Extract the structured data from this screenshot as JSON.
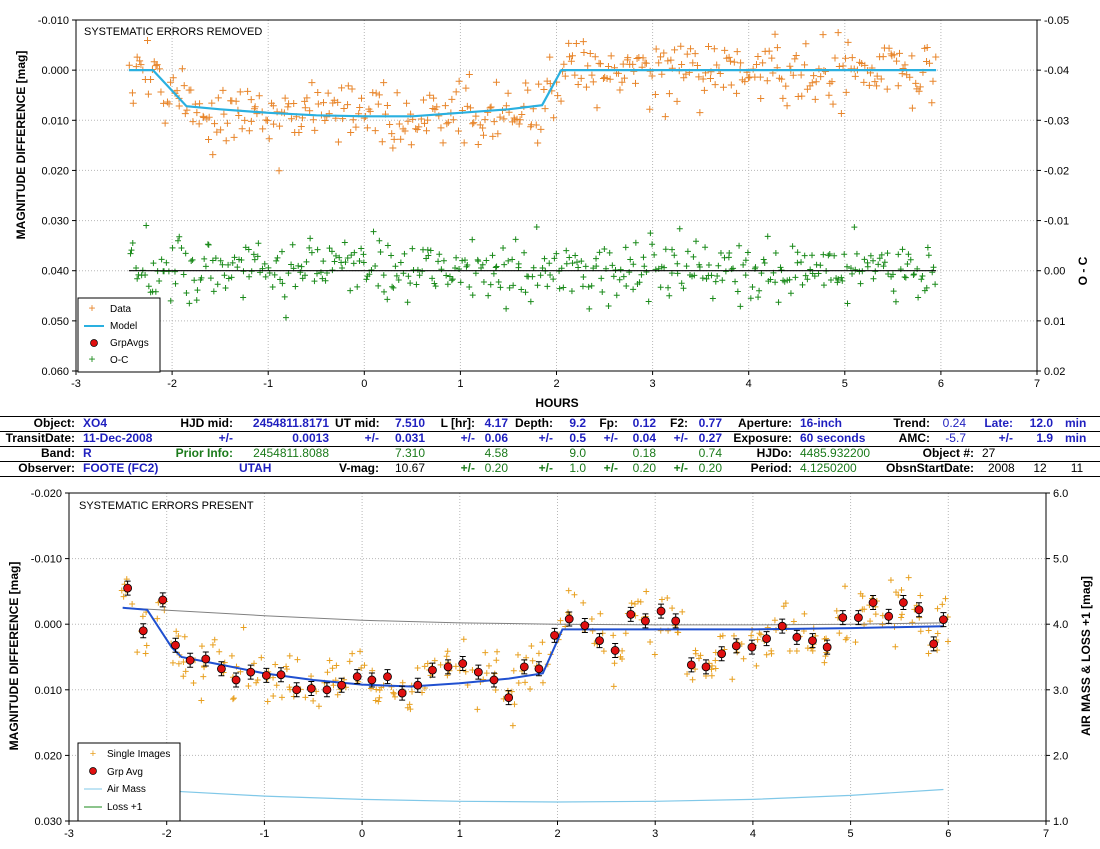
{
  "chart_data": [
    {
      "type": "scatter",
      "title": "SYSTEMATIC ERRORS REMOVED",
      "xlabel": "HOURS",
      "ylabel": "MAGNITUDE DIFFERENCE [mag]",
      "y2label": "O - C",
      "xlim": [
        -3,
        7
      ],
      "ylim": [
        -0.01,
        0.06
      ],
      "y_inverted": true,
      "y2lim": [
        -0.05,
        0.02
      ],
      "x_ticks": [
        "-3",
        "-2",
        "-1",
        "0",
        "1",
        "2",
        "3",
        "4",
        "5",
        "6",
        "7"
      ],
      "y_ticks": [
        "-0.010",
        "0.000",
        "0.010",
        "0.020",
        "0.030",
        "0.040",
        "0.050",
        "0.060"
      ],
      "y2_ticks": [
        "-0.05",
        "-0.04",
        "-0.03",
        "-0.02",
        "-0.01",
        "0.00",
        "0.01",
        "0.02"
      ],
      "grid": true,
      "legend_position": "bottom-left",
      "legend": [
        "Data",
        "Model",
        "GrpAvgs",
        "O-C"
      ],
      "colors": {
        "data": "#e8852a",
        "model": "#2ab0e0",
        "grpavg": "#e01010",
        "oc": "#1a8a1a"
      },
      "model": {
        "x": [
          -2.45,
          -2.2,
          -1.85,
          -1.5,
          -1.0,
          -0.5,
          0.0,
          0.5,
          1.0,
          1.5,
          1.85,
          2.05,
          2.5,
          3.0,
          4.0,
          5.0,
          5.95
        ],
        "y": [
          0.0,
          0.0,
          0.0072,
          0.0078,
          0.0085,
          0.009,
          0.0092,
          0.0092,
          0.0085,
          0.0078,
          0.007,
          0.0,
          0.0,
          0.0,
          0.0,
          0.0,
          0.0
        ]
      },
      "oc_zero_line": {
        "x": [
          -2.45,
          5.95
        ],
        "y": [
          0.0,
          0.0
        ]
      },
      "data_segments": [
        {
          "x_range": [
            -2.45,
            -2.1
          ],
          "center": 0.0,
          "scatter": 0.003
        },
        {
          "x_range": [
            -2.1,
            -1.85
          ],
          "center": 0.005,
          "scatter": 0.003
        },
        {
          "x_range": [
            -1.85,
            1.85
          ],
          "center": 0.0088,
          "scatter": 0.003
        },
        {
          "x_range": [
            1.85,
            2.05
          ],
          "center": 0.004,
          "scatter": 0.004
        },
        {
          "x_range": [
            2.05,
            5.95
          ],
          "center": 0.0,
          "scatter": 0.003
        }
      ],
      "oc_segment": {
        "x_range": [
          -2.45,
          5.95
        ],
        "center": 0.0,
        "scatter": 0.003
      }
    },
    {
      "type": "scatter",
      "title": "SYSTEMATIC ERRORS PRESENT",
      "xlabel": "",
      "ylabel": "MAGNITUDE DIFFERENCE [mag]",
      "y2label": "AIR MASS & LOSS +1 [mag]",
      "xlim": [
        -3,
        7
      ],
      "ylim": [
        -0.02,
        0.03
      ],
      "y_inverted": true,
      "y2lim": [
        1.0,
        6.0
      ],
      "x_ticks": [
        "-3",
        "-2",
        "-1",
        "0",
        "1",
        "2",
        "3",
        "4",
        "5",
        "6",
        "7"
      ],
      "y_ticks": [
        "-0.020",
        "-0.010",
        "0.000",
        "0.010",
        "0.020",
        "0.030"
      ],
      "y2_ticks": [
        "1.0",
        "2.0",
        "3.0",
        "4.0",
        "5.0",
        "6.0"
      ],
      "grid": true,
      "legend_position": "bottom-left",
      "legend": [
        "Single Images",
        "Grp Avg",
        "Air Mass",
        "Loss +1"
      ],
      "colors": {
        "single": "#e8a020",
        "grpavg": "#e01010",
        "model": "#2050d0",
        "airmass": "#80c8e8",
        "loss": "#1a8a1a",
        "trend": "#808080"
      },
      "model": {
        "x": [
          -2.45,
          -2.2,
          -1.95,
          -1.85,
          -1.5,
          -1.0,
          -0.5,
          0.0,
          0.5,
          1.0,
          1.5,
          1.85,
          2.05,
          2.5,
          3.0,
          4.0,
          5.0,
          5.95
        ],
        "y": [
          -0.0025,
          -0.0022,
          0.0035,
          0.005,
          0.006,
          0.0075,
          0.0085,
          0.0092,
          0.0095,
          0.009,
          0.0083,
          0.0075,
          0.0008,
          0.0008,
          0.0008,
          0.0008,
          0.0006,
          0.0003
        ]
      },
      "trend": {
        "x": [
          -2.45,
          -1.0,
          0.0,
          1.0,
          2.0,
          3.0,
          4.0,
          5.0,
          5.95
        ],
        "y": [
          -0.0025,
          -0.0013,
          -0.0006,
          -0.0002,
          0.0,
          0.0001,
          0.0001,
          0.0,
          -0.0002
        ]
      },
      "air_mass": {
        "x": [
          -2.0,
          -1.0,
          0.0,
          1.0,
          2.0,
          3.0,
          4.0,
          5.0,
          5.95
        ],
        "y": [
          1.46,
          1.38,
          1.33,
          1.3,
          1.29,
          1.3,
          1.33,
          1.39,
          1.48
        ]
      },
      "group_averages": {
        "x": [
          -2.4,
          -2.24,
          -2.04,
          -1.91,
          -1.76,
          -1.6,
          -1.44,
          -1.29,
          -1.14,
          -0.98,
          -0.83,
          -0.67,
          -0.52,
          -0.36,
          -0.21,
          -0.05,
          0.1,
          0.26,
          0.41,
          0.57,
          0.72,
          0.88,
          1.03,
          1.19,
          1.35,
          1.5,
          1.66,
          1.81,
          1.97,
          2.12,
          2.28,
          2.43,
          2.59,
          2.75,
          2.9,
          3.06,
          3.21,
          3.37,
          3.52,
          3.68,
          3.83,
          3.99,
          4.14,
          4.3,
          4.45,
          4.61,
          4.76,
          4.92,
          5.08,
          5.23,
          5.39,
          5.54,
          5.7,
          5.85,
          5.95
        ],
        "y": [
          -0.0055,
          0.001,
          -0.0037,
          0.0032,
          0.0055,
          0.0053,
          0.0068,
          0.0085,
          0.0073,
          0.0078,
          0.0077,
          0.01,
          0.0098,
          0.01,
          0.0093,
          0.008,
          0.0085,
          0.008,
          0.0105,
          0.0093,
          0.007,
          0.0065,
          0.006,
          0.0073,
          0.0085,
          0.0112,
          0.0065,
          0.0068,
          0.0017,
          -0.0008,
          0.0002,
          0.0025,
          0.004,
          -0.0015,
          -0.0005,
          -0.002,
          -0.0005,
          0.0062,
          0.0065,
          0.0045,
          0.0033,
          0.0035,
          0.0022,
          0.0003,
          0.002,
          0.0025,
          0.0035,
          -0.001,
          -0.001,
          -0.0033,
          -0.0012,
          -0.0033,
          -0.0022,
          0.003,
          -0.0007
        ]
      }
    }
  ],
  "info": {
    "row1": {
      "object_label": "Object:",
      "object_value": "XO4",
      "hjd_label": "HJD mid:",
      "hjd_value": "2454811.8171",
      "ut_label": "UT mid:",
      "ut_value": "7.510",
      "l_label": "L [hr]:",
      "l_value": "4.17",
      "depth_label": "Depth:",
      "depth_value": "9.2",
      "fp_label": "Fp:",
      "fp_value": "0.12",
      "f2_label": "F2:",
      "f2_value": "0.77",
      "aperture_label": "Aperture:",
      "aperture_value": "16-inch",
      "trend_label": "Trend:",
      "trend_value": "0.24",
      "late_label": "Late:",
      "late_value": "12.0",
      "late_unit": "min"
    },
    "row2": {
      "transitdate_label": "TransitDate:",
      "transitdate_value": "11-Dec-2008",
      "pm_hjd": "+/-",
      "hjd_err": "0.0013",
      "pm_ut": "+/-",
      "ut_err": "0.031",
      "pm_l": "+/-",
      "l_err": "0.06",
      "pm_depth": "+/-",
      "depth_err": "0.5",
      "pm_fp": "+/-",
      "fp_err": "0.04",
      "pm_f2": "+/-",
      "f2_err": "0.27",
      "exposure_label": "Exposure:",
      "exposure_value": "60 seconds",
      "amc_label": "AMC:",
      "amc_value": "-5.7",
      "pm_late": "+/-",
      "late_err": "1.9",
      "late_err_unit": "min"
    },
    "row3": {
      "band_label": "Band:",
      "band_value": "R",
      "prior_label": "Prior Info:",
      "prior_hjd": "2454811.8088",
      "prior_ut": "7.310",
      "prior_l": "4.58",
      "prior_depth": "9.0",
      "prior_fp": "0.18",
      "prior_f2": "0.74",
      "hjdo_label": "HJDo:",
      "hjdo_value": "4485.932200",
      "objnum_label": "Object #:",
      "objnum_value": "27"
    },
    "row4": {
      "observer_label": "Observer:",
      "observer_value": "FOOTE (FC2)",
      "location_value": "UTAH",
      "vmag_label": "V-mag:",
      "vmag_value": "10.67",
      "pm1": "+/-",
      "err1": "0.20",
      "pm2": "+/-",
      "err2": "1.0",
      "pm3": "+/-",
      "err3": "0.20",
      "pm4": "+/-",
      "err4": "0.20",
      "period_label": "Period:",
      "period_value": "4.1250200",
      "obsstart_label": "ObsnStartDate:",
      "obsstart_year": "2008",
      "obsstart_month": "12",
      "obsstart_day": "11"
    }
  }
}
